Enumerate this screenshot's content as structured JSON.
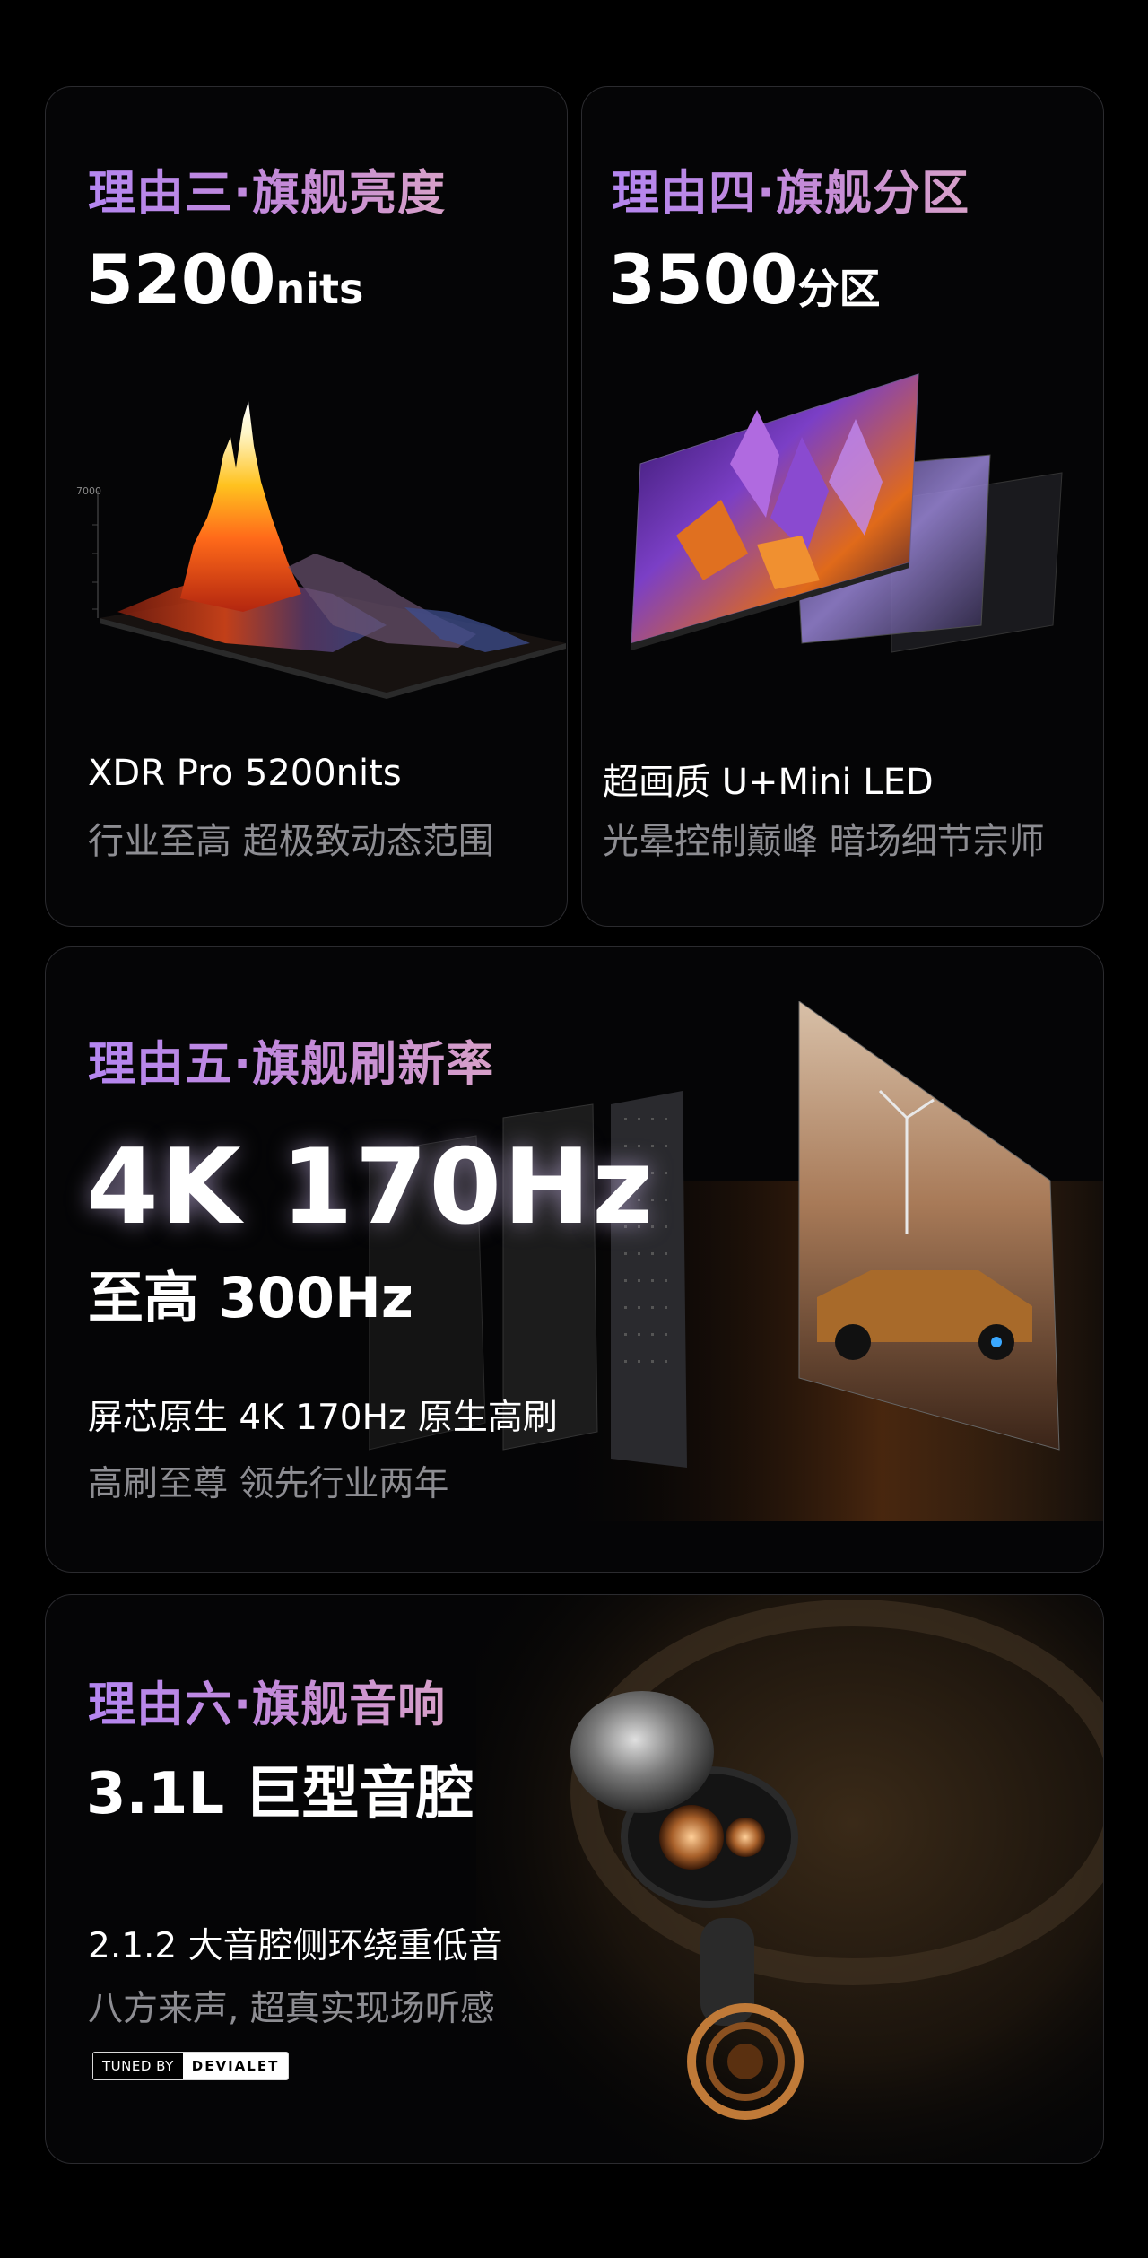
{
  "cards": {
    "brightness": {
      "title": "理由三·旗舰亮度",
      "value": "5200",
      "unit": "nits",
      "line1": "XDR Pro 5200nits",
      "line2": "行业至高 超极致动态范围",
      "chart_axis_top": "7000"
    },
    "zones": {
      "title": "理由四·旗舰分区",
      "value": "3500",
      "unit": "分区",
      "line1": "超画质 U+Mini LED",
      "line2": "光晕控制巅峰 暗场细节宗师"
    },
    "refresh": {
      "title": "理由五·旗舰刷新率",
      "value": "4K 170Hz",
      "sub": "至高 300Hz",
      "line1": "屏芯原生 4K 170Hz 原生高刷",
      "line2": "高刷至尊 领先行业两年"
    },
    "audio": {
      "title": "理由六·旗舰音响",
      "value": "3.1L 巨型音腔",
      "line1": "2.1.2  大音腔侧环绕重低音",
      "line2": "八方来声, 超真实现场听感",
      "badge_left": "TUNED BY",
      "badge_right": "DEVIALET"
    }
  }
}
